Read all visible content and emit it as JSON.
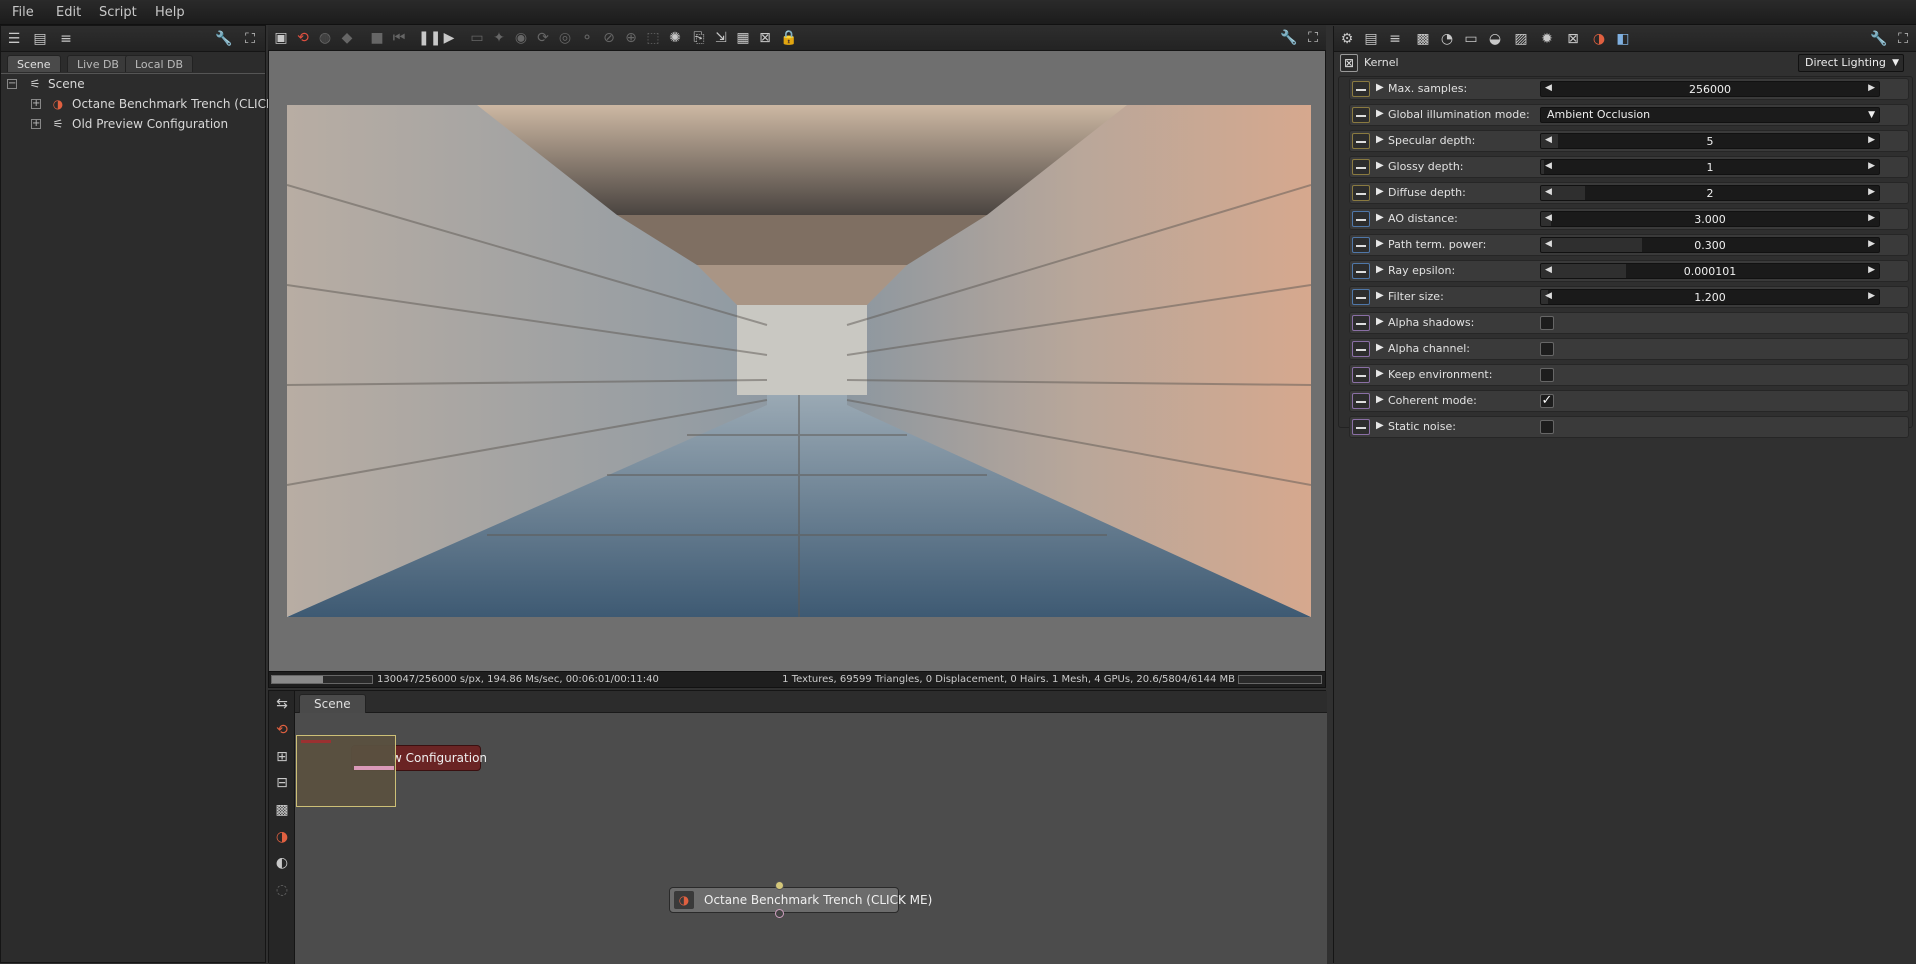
{
  "menu": {
    "items": [
      "File",
      "Edit",
      "Script",
      "Help"
    ]
  },
  "scene_panel": {
    "tabs": [
      "Scene",
      "Live DB",
      "Local DB"
    ],
    "tree": {
      "root": "Scene",
      "children": [
        "Octane Benchmark Trench (CLICK ME)",
        "Old Preview Configuration"
      ]
    }
  },
  "status": {
    "progress": 0.508,
    "left_text": "130047/256000 s/px, 194.86 Ms/sec, 00:06:01/00:11:40",
    "right_text": "1 Textures, 69599 Triangles, 0 Displacement, 0 Hairs. 1 Mesh, 4 GPUs, 20.6/5804/6144 MB"
  },
  "graph": {
    "tab": "Scene",
    "nodes": {
      "config_label": "w Configuration",
      "trench_label": "Octane Benchmark Trench (CLICK ME)"
    }
  },
  "kernel": {
    "header_label": "Kernel",
    "kernel_type": "Direct Lighting",
    "rows": [
      {
        "label": "Max. samples:",
        "type": "slider",
        "value": "256000",
        "fill": 0.0,
        "icon": "int"
      },
      {
        "label": "Global illumination mode:",
        "type": "combo",
        "value": "Ambient Occlusion",
        "icon": "int"
      },
      {
        "label": "Specular depth:",
        "type": "slider",
        "value": "5",
        "fill": 0.05,
        "icon": "int"
      },
      {
        "label": "Glossy depth:",
        "type": "slider",
        "value": "1",
        "fill": 0.01,
        "icon": "int"
      },
      {
        "label": "Diffuse depth:",
        "type": "slider",
        "value": "2",
        "fill": 0.13,
        "icon": "int"
      },
      {
        "label": "AO distance:",
        "type": "slider",
        "value": "3.000",
        "fill": 0.03,
        "icon": "float"
      },
      {
        "label": "Path term. power:",
        "type": "slider",
        "value": "0.300",
        "fill": 0.3,
        "icon": "float"
      },
      {
        "label": "Ray epsilon:",
        "type": "slider",
        "value": "0.000101",
        "fill": 0.25,
        "icon": "float"
      },
      {
        "label": "Filter size:",
        "type": "slider",
        "value": "1.200",
        "fill": 0.02,
        "icon": "float"
      },
      {
        "label": "Alpha shadows:",
        "type": "check",
        "checked": false,
        "icon": "bool"
      },
      {
        "label": "Alpha channel:",
        "type": "check",
        "checked": false,
        "icon": "bool"
      },
      {
        "label": "Keep environment:",
        "type": "check",
        "checked": false,
        "icon": "bool"
      },
      {
        "label": "Coherent mode:",
        "type": "check",
        "checked": true,
        "icon": "bool"
      },
      {
        "label": "Static noise:",
        "type": "check",
        "checked": false,
        "icon": "bool"
      }
    ]
  },
  "colors": {
    "accent": "#d4c77a",
    "node_red": "#7a2a2a",
    "node_gray": "#6e6e6e"
  },
  "icons": [
    "scene-outliner-icon",
    "wrench-icon",
    "maximize-icon",
    "pause-icon",
    "play-icon",
    "lock-icon",
    "stop-icon",
    "restart-icon",
    "check-icon"
  ]
}
